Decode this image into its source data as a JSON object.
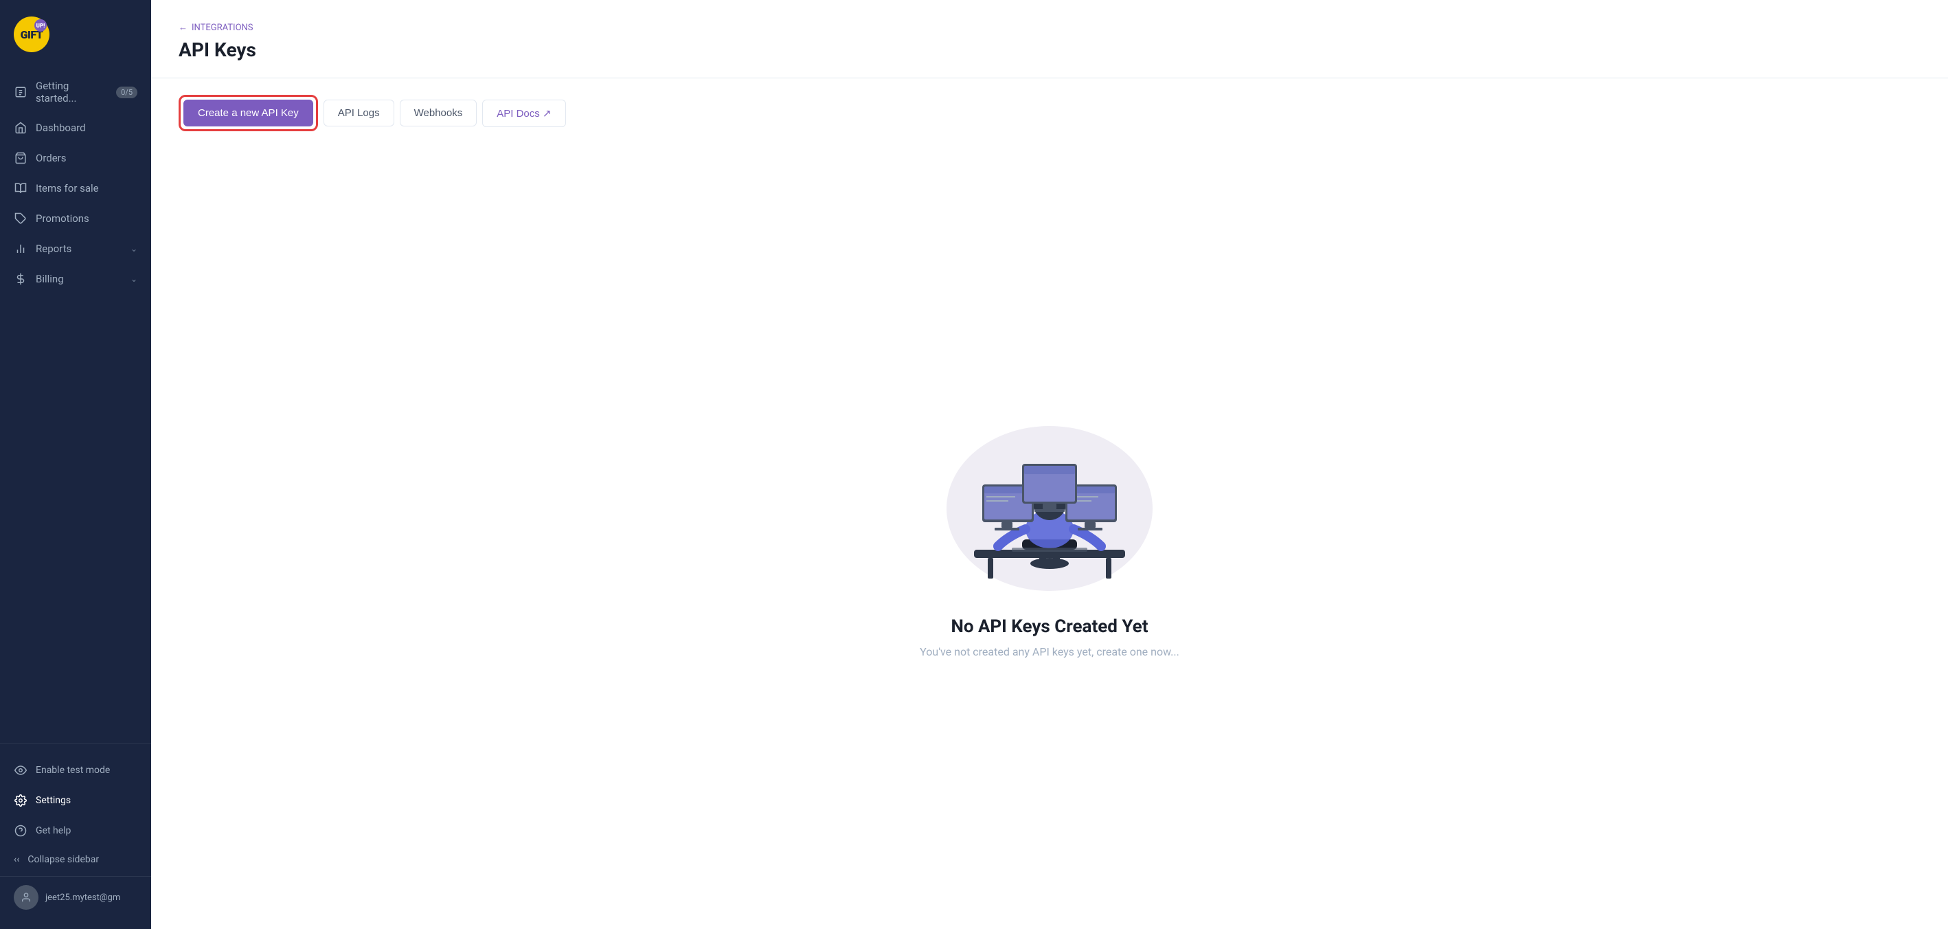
{
  "sidebar": {
    "logo": {
      "gift_text": "GIFT",
      "up_text": "UP!"
    },
    "nav_items": [
      {
        "id": "getting-started",
        "label": "Getting started...",
        "badge": "0/5",
        "icon": "file"
      },
      {
        "id": "dashboard",
        "label": "Dashboard",
        "icon": "home"
      },
      {
        "id": "orders",
        "label": "Orders",
        "icon": "shopping-bag"
      },
      {
        "id": "items-for-sale",
        "label": "Items for sale",
        "icon": "book-open"
      },
      {
        "id": "promotions",
        "label": "Promotions",
        "icon": "tag"
      },
      {
        "id": "reports",
        "label": "Reports",
        "icon": "bar-chart",
        "chevron": true
      },
      {
        "id": "billing",
        "label": "Billing",
        "icon": "dollar-sign",
        "chevron": true
      }
    ],
    "bottom_items": [
      {
        "id": "enable-test-mode",
        "label": "Enable test mode",
        "icon": "eye"
      },
      {
        "id": "settings",
        "label": "Settings",
        "icon": "settings",
        "active": true
      },
      {
        "id": "get-help",
        "label": "Get help",
        "icon": "help-circle"
      }
    ],
    "collapse_label": "Collapse sidebar",
    "user_email": "jeet25.mytest@gm"
  },
  "header": {
    "breadcrumb_icon": "←",
    "breadcrumb_label": "INTEGRATIONS",
    "page_title": "API Keys"
  },
  "tabs": [
    {
      "id": "create-api-key",
      "label": "Create a new API Key",
      "style": "primary",
      "highlighted": true
    },
    {
      "id": "api-logs",
      "label": "API Logs",
      "style": "secondary"
    },
    {
      "id": "webhooks",
      "label": "Webhooks",
      "style": "secondary"
    },
    {
      "id": "api-docs",
      "label": "API Docs ↗",
      "style": "link"
    }
  ],
  "empty_state": {
    "title": "No API Keys Created Yet",
    "subtitle": "You've not created any API keys yet, create one now..."
  }
}
